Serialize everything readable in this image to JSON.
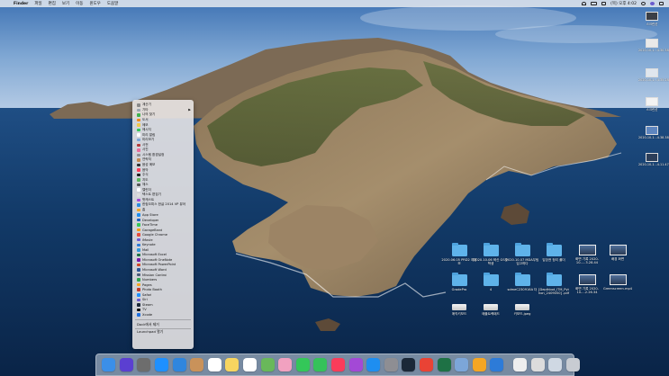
{
  "menubar": {
    "apple": "",
    "app_name": "Finder",
    "menus": [
      "파일",
      "편집",
      "보기",
      "이동",
      "윈도우",
      "도움말"
    ],
    "clock": "(목) 오후 4:02"
  },
  "launch_menu": {
    "items": [
      {
        "label": "계산기",
        "color": "#8a8a8a"
      },
      {
        "label": "기타",
        "color": "#9aa5b1",
        "submenu": true
      },
      {
        "label": "나의 찾기",
        "color": "#3fb24f"
      },
      {
        "label": "도서",
        "color": "#f08a1c"
      },
      {
        "label": "메모",
        "color": "#f2c94c"
      },
      {
        "label": "메시지",
        "color": "#34c759"
      },
      {
        "label": "미리 알림",
        "color": "#ffffff"
      },
      {
        "label": "미리보기",
        "color": "#7ca6d9"
      },
      {
        "label": "사전",
        "color": "#b33b3b"
      },
      {
        "label": "사진",
        "color": "#e86f9d"
      },
      {
        "label": "시스템 환경설정",
        "color": "#8e8e93"
      },
      {
        "label": "연락처",
        "color": "#c48a53"
      },
      {
        "label": "음성 메모",
        "color": "#333333"
      },
      {
        "label": "음악",
        "color": "#fa3c5a"
      },
      {
        "label": "주식",
        "color": "#222222"
      },
      {
        "label": "지도",
        "color": "#5cb85c"
      },
      {
        "label": "체스",
        "color": "#555555"
      },
      {
        "label": "캘린더",
        "color": "#ffffff"
      },
      {
        "label": "텍스트 편집기",
        "color": "#dddddd"
      },
      {
        "label": "팟캐스트",
        "color": "#a349d6"
      },
      {
        "label": "한컴오피스 한글 2014 VP 뷰어",
        "color": "#2a8de0"
      },
      {
        "label": "홈",
        "color": "#f5a623"
      },
      {
        "label": "App Store",
        "color": "#1e8ef0"
      },
      {
        "label": "Developer",
        "color": "#1f5fbf"
      },
      {
        "label": "FaceTime",
        "color": "#34c759"
      },
      {
        "label": "GarageBand",
        "color": "#f39c12"
      },
      {
        "label": "Google Chrome",
        "color": "#e74c3c"
      },
      {
        "label": "iMovie",
        "color": "#6b5bd6"
      },
      {
        "label": "Keynote",
        "color": "#2d7bd8"
      },
      {
        "label": "Mail",
        "color": "#3498db"
      },
      {
        "label": "Microsoft Excel",
        "color": "#1e7145"
      },
      {
        "label": "Microsoft OneNote",
        "color": "#7719aa"
      },
      {
        "label": "Microsoft PowerPoint",
        "color": "#d24726"
      },
      {
        "label": "Microsoft Word",
        "color": "#2b579a"
      },
      {
        "label": "Mission Control",
        "color": "#4a5a7a"
      },
      {
        "label": "Numbers",
        "color": "#2ea44f"
      },
      {
        "label": "Pages",
        "color": "#f5a623"
      },
      {
        "label": "Photo Booth",
        "color": "#c0392b"
      },
      {
        "label": "Safari",
        "color": "#1e90ff"
      },
      {
        "label": "Siri",
        "color": "#6a5acd"
      },
      {
        "label": "Steam",
        "color": "#1b2838"
      },
      {
        "label": "TV",
        "color": "#111111"
      },
      {
        "label": "Xcode",
        "color": "#1d6fe0"
      }
    ],
    "footer_items": [
      "Dock에서 제거",
      "Launchpad 열기"
    ]
  },
  "desktop_items": [
    {
      "kind": "folder",
      "label": "2020.06.05 PRD2 예중보"
    },
    {
      "kind": "folder",
      "label": "2020.10.06 혁신 GS등 학생"
    },
    {
      "kind": "folder",
      "label": "2020.10.07 MDA무팀 입고하다"
    },
    {
      "kind": "folder",
      "label": "입장권 정리 폴더"
    },
    {
      "kind": "shot",
      "label": "화면 기록 2020-10-....3.28.44"
    },
    {
      "kind": "shot",
      "label": "배경 화면"
    },
    {
      "kind": "folder",
      "label": "GradePro"
    },
    {
      "kind": "folder",
      "label": "4"
    },
    {
      "kind": "folder",
      "label": "sdmeC230916A 더"
    },
    {
      "kind": "folder",
      "label": "[Depthbot_ITM_Pyt hon_2409050] .pdf"
    },
    {
      "kind": "shot",
      "label": "화면 기록 2020-10-...2.26.34"
    },
    {
      "kind": "shot",
      "label": "Greenscreen.mp4"
    },
    {
      "kind": "kbd",
      "label": "매직키보드"
    },
    {
      "kind": "kbd",
      "label": "애플트랙패드"
    },
    {
      "kind": "kbd",
      "label": "키보드.jpeg"
    }
  ],
  "right_files": [
    {
      "label": "스크린샷"
    },
    {
      "label": "2020-10-1...4.30.38"
    },
    {
      "label": "2020-10-1...4.35.28"
    },
    {
      "label": "스크린샷"
    },
    {
      "label": "2020-10-1...4.38.38"
    },
    {
      "label": "2020-10-1...4.11.47"
    }
  ],
  "dock": {
    "icons": [
      {
        "name": "finder-icon",
        "color": "#3b8fe8"
      },
      {
        "name": "siri-icon",
        "color": "#5b3fd1"
      },
      {
        "name": "launchpad-icon",
        "color": "#6d6d6d"
      },
      {
        "name": "safari-icon",
        "color": "#1e90ff"
      },
      {
        "name": "mail-icon",
        "color": "#2f86de"
      },
      {
        "name": "contacts-icon",
        "color": "#c9925a"
      },
      {
        "name": "calendar-icon",
        "color": "#ffffff"
      },
      {
        "name": "notes-icon",
        "color": "#f7d560"
      },
      {
        "name": "reminders-icon",
        "color": "#ffffff"
      },
      {
        "name": "maps-icon",
        "color": "#69b85a"
      },
      {
        "name": "photos-icon",
        "color": "#f1a1c0"
      },
      {
        "name": "facetime-icon",
        "color": "#34c759"
      },
      {
        "name": "messages-icon",
        "color": "#35c25a"
      },
      {
        "name": "music-icon",
        "color": "#fa3c5a"
      },
      {
        "name": "podcasts-icon",
        "color": "#a349d6"
      },
      {
        "name": "appstore-icon",
        "color": "#1e8ef0"
      },
      {
        "name": "system-preferences-icon",
        "color": "#8e8e93"
      },
      {
        "name": "steam-icon",
        "color": "#1b2838"
      },
      {
        "name": "chrome-icon",
        "color": "#e94335"
      },
      {
        "name": "excel-icon",
        "color": "#1e7145"
      },
      {
        "name": "preview-icon",
        "color": "#7ca6d9"
      },
      {
        "name": "pages-icon",
        "color": "#f5a623"
      },
      {
        "name": "keynote-icon",
        "color": "#2d7bd8"
      },
      {
        "name": "textedit-icon",
        "color": "#eeeeee"
      },
      {
        "name": "documents-icon",
        "color": "#dcdcdc"
      },
      {
        "name": "downloads-icon",
        "color": "#cfd8e3"
      },
      {
        "name": "trash-icon",
        "color": "#c8ccd2"
      }
    ]
  }
}
